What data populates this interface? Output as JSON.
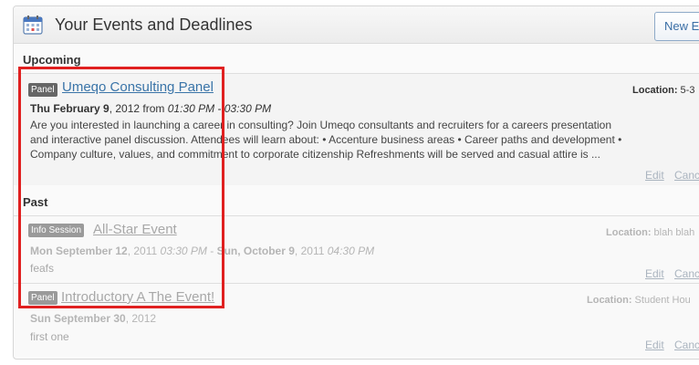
{
  "header": {
    "title": "Your Events and Deadlines",
    "new_button": "New Ev"
  },
  "sections": {
    "upcoming": "Upcoming",
    "past": "Past"
  },
  "events": [
    {
      "type": "Panel",
      "title": "Umeqo Consulting Panel",
      "date_bold": "Thu February 9",
      "date_rest": ", 2012 from ",
      "time_range": "01:30 PM - 03:30 PM",
      "description": "Are you interested in launching a career in consulting? Join Umeqo consultants and recruiters for a careers presentation and interactive panel discussion. Attendees will learn about: • Accenture business areas • Career paths and development • Company culture, values, and commitment to corporate citizenship Refreshments will be served and casual attire is ...",
      "location_label": "Location:",
      "location_value": " 5-3",
      "edit": "Edit",
      "cancel": "Canc"
    },
    {
      "type": "Info Session",
      "title": "All-Star Event",
      "start_bold": "Mon September 12",
      "start_year": ", 2011 ",
      "start_time": "03:30 PM",
      "separator": " - ",
      "end_bold": "Sun, October 9",
      "end_year": ", 2011 ",
      "end_time": "04:30 PM",
      "description": "feafs",
      "location_label": "Location:",
      "location_value": " blah blah",
      "edit": "Edit",
      "cancel": "Canc"
    },
    {
      "type": "Panel",
      "title": "Introductory A The Event!",
      "date_bold": "Sun September 30",
      "date_rest": ", 2012",
      "description": "first one",
      "location_label": "Location:",
      "location_value": " Student Hou",
      "edit": "Edit",
      "cancel": "Canc"
    }
  ],
  "colors": {
    "link": "#3a74a8",
    "highlight": "#e02020",
    "faded": "#a8a8a8"
  }
}
